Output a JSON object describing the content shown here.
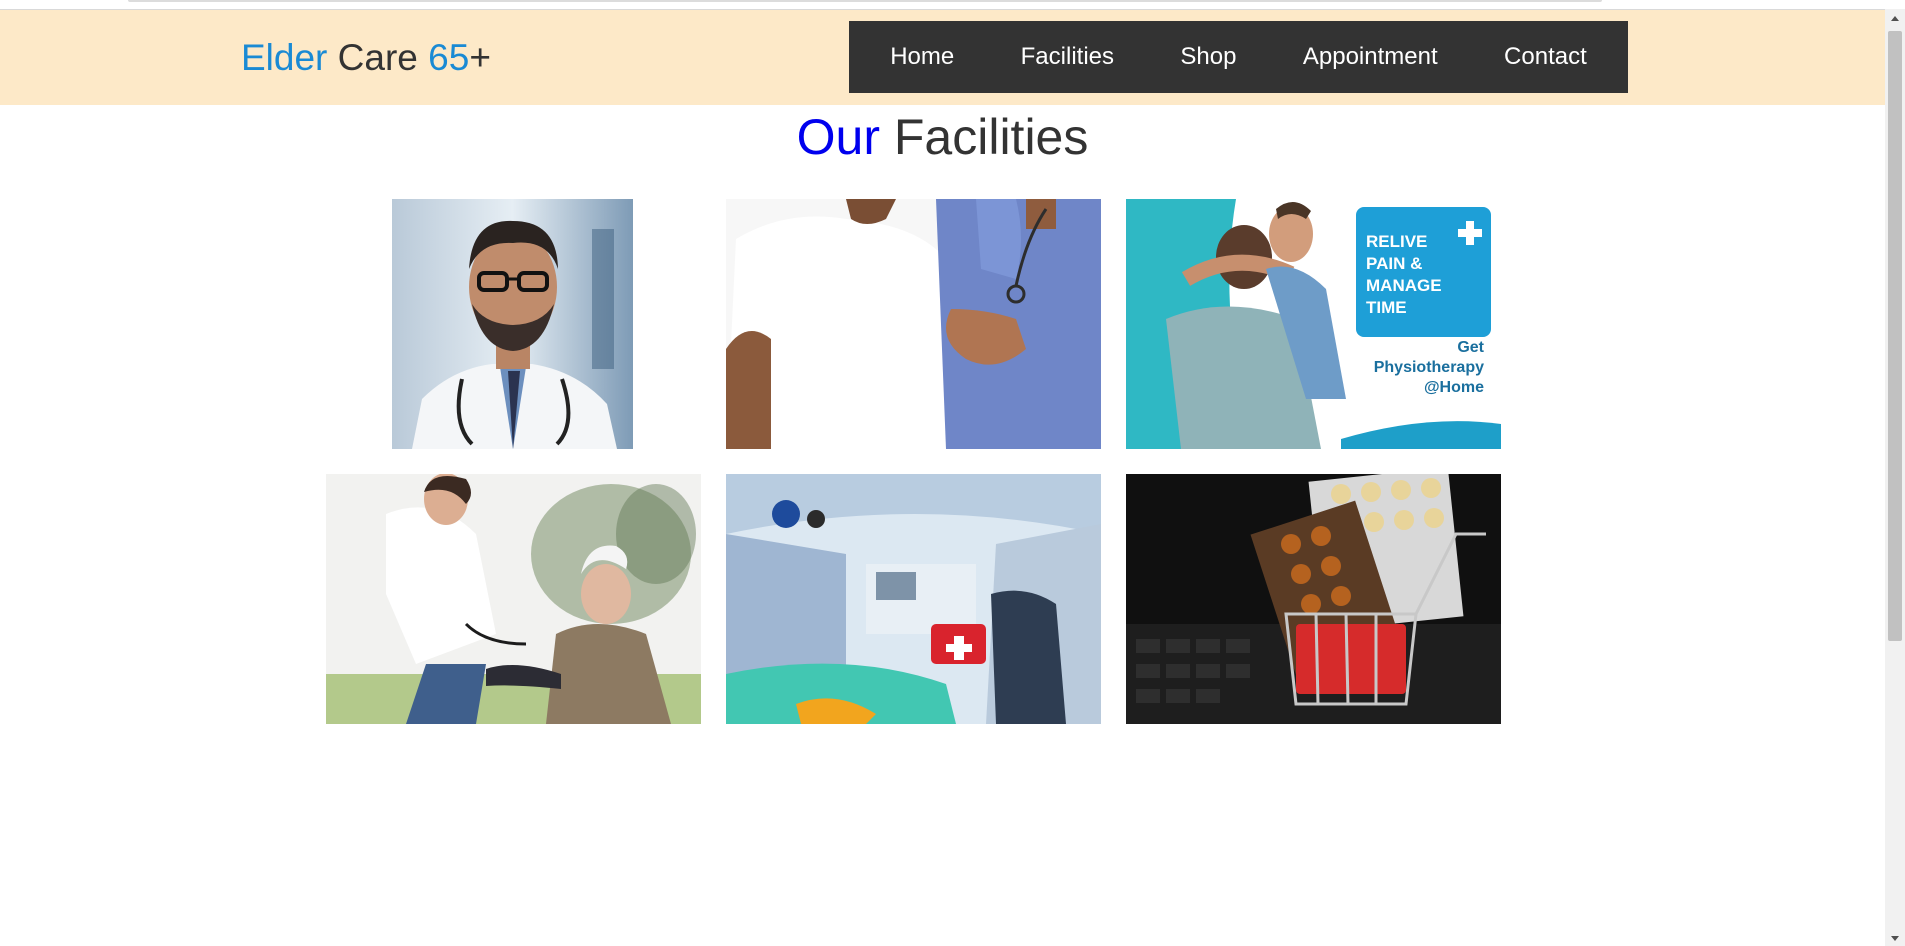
{
  "logo": {
    "part1": "Elder",
    "part2": " Care ",
    "part3": "65",
    "part4": "+"
  },
  "nav": {
    "items": [
      "Home",
      "Facilities",
      "Shop",
      "Appointment",
      "Contact"
    ]
  },
  "page_title": {
    "accent": "Our",
    "rest": " Facilities"
  },
  "facility_images": [
    {
      "subject": "doctor portrait"
    },
    {
      "subject": "nurse assisting elderly man"
    },
    {
      "subject": "physiotherapy at home banner",
      "banner_text": {
        "line1": "RELIVE",
        "line2": "PAIN &",
        "line3": "MANAGE",
        "line4": "TIME",
        "cta1": "Get",
        "cta2": "Physiotherapy",
        "cta3": "@Home"
      }
    },
    {
      "subject": "nurse checking blood pressure of elderly man"
    },
    {
      "subject": "ambulance interior"
    },
    {
      "subject": "medicine blister packs in shopping cart"
    }
  ],
  "colors": {
    "header_bg": "#fde9c8",
    "nav_bg": "#333333",
    "logo_accent": "#1a8ad4",
    "title_accent": "#0000ee"
  }
}
